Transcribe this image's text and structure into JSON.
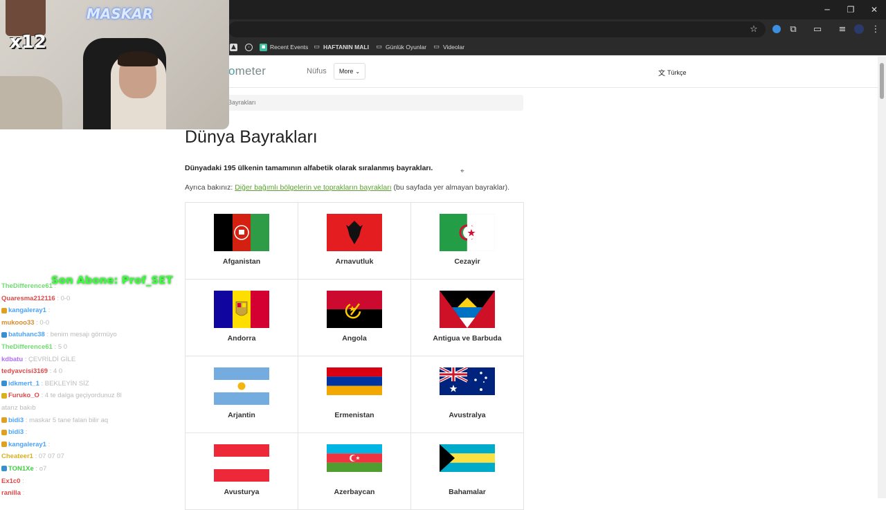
{
  "window": {
    "minimize": "─",
    "restore": "❐",
    "close": "✕"
  },
  "bookmarks": [
    {
      "label": "Recent Events",
      "icon": "events-icon"
    },
    {
      "label": "HAFTANIN MALI",
      "icon": "folder-icon"
    },
    {
      "label": "Günlük Oyunlar",
      "icon": "folder-icon"
    },
    {
      "label": "Videolar",
      "icon": "folder-icon"
    }
  ],
  "header": {
    "logo_prefix": "o",
    "logo_rest": "meter",
    "nav_nufus": "Nüfus",
    "nav_more": "More",
    "language": "Türkçe"
  },
  "breadcrumb": "Bayrakları",
  "page": {
    "title": "Dünya Bayrakları",
    "intro": "Dünyadaki 195 ülkenin tamamının alfabetik olarak sıralanmış bayrakları.",
    "see_also_prefix": "Ayrıca bakınız: ",
    "see_also_link": "Diğer bağımlı bölgelerin ve toprakların bayrakları",
    "see_also_suffix": " (bu sayfada yer almayan bayraklar)."
  },
  "countries": [
    {
      "name": "Afganistan",
      "flag": "afghanistan"
    },
    {
      "name": "Arnavutluk",
      "flag": "albania"
    },
    {
      "name": "Cezayir",
      "flag": "algeria"
    },
    {
      "name": "Andorra",
      "flag": "andorra"
    },
    {
      "name": "Angola",
      "flag": "angola"
    },
    {
      "name": "Antigua ve Barbuda",
      "flag": "antigua"
    },
    {
      "name": "Arjantin",
      "flag": "argentina"
    },
    {
      "name": "Ermenistan",
      "flag": "armenia"
    },
    {
      "name": "Avustralya",
      "flag": "australia"
    },
    {
      "name": "Avusturya",
      "flag": "austria"
    },
    {
      "name": "Azerbaycan",
      "flag": "azerbaijan"
    },
    {
      "name": "Bahamalar",
      "flag": "bahamas"
    }
  ],
  "stream": {
    "streamer": "MASKAR",
    "multiplier": "x12",
    "last_sub": "Son Abone: Prof_SET",
    "chat": [
      {
        "user": "TheDifference61",
        "text": ": ",
        "color": "#6fdc6f"
      },
      {
        "user": "Quaresma212116",
        "text": ": 0-0",
        "color": "#e04848"
      },
      {
        "user": "kangaleray1",
        "text": ": ",
        "color": "#4aa3ff",
        "badge": "#e0a020"
      },
      {
        "user": "mukooo33",
        "text": ": 0-0",
        "color": "#d98b2b"
      },
      {
        "user": "batuhanc38",
        "text": ": benim mesajı görmüyo",
        "color": "#4aa3ff",
        "badge": "#3a8fd0"
      },
      {
        "user": "TheDifference61",
        "text": ": 5 0",
        "color": "#6fdc6f"
      },
      {
        "user": "kdbatu",
        "text": ": ÇEVRİLDİ GİLE",
        "color": "#b06cff"
      },
      {
        "user": "tedyavcisi3169",
        "text": ": 4 0",
        "color": "#e04848"
      },
      {
        "user": "idkmert_1",
        "text": ": BEKLEYİN SİZ",
        "color": "#4aa3ff",
        "badge": "#3a8fd0"
      },
      {
        "user": "Furuko_O",
        "text": ": 4 te dalga geçiyordunuz 8l",
        "color": "#e04848",
        "badge": "#d8b020"
      },
      {
        "continuation": "atarız bakıb"
      },
      {
        "user": "bidi3",
        "text": ": maskar 5 tane falan bilir aq",
        "color": "#4aa3ff",
        "badge": "#e0a020"
      },
      {
        "user": "bidi3",
        "text": ": ",
        "color": "#4aa3ff",
        "badge": "#e0a020"
      },
      {
        "user": "kangaleray1",
        "text": ": ",
        "color": "#4aa3ff",
        "badge": "#e0a020"
      },
      {
        "user": "Cheateer1",
        "text": ": 07 07 07",
        "color": "#d8b020"
      },
      {
        "user": "TON1Xe",
        "text": ": o7",
        "color": "#3fd03f",
        "badge": "#3a8fd0"
      },
      {
        "user": "Ex1c0",
        "text": ": ",
        "color": "#e04848"
      },
      {
        "user": "ranilla",
        "text": ": ",
        "color": "#e04848"
      }
    ]
  }
}
